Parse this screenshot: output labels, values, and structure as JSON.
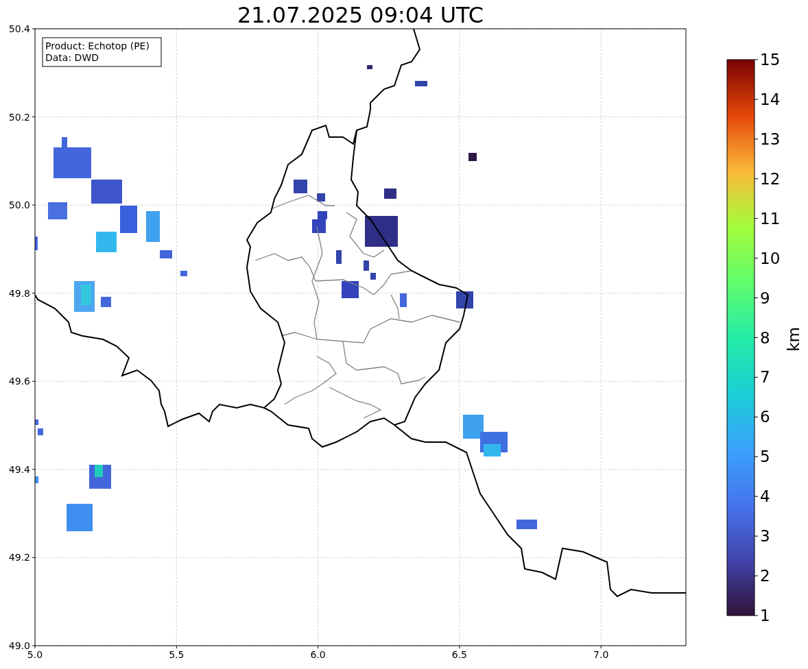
{
  "title": "21.07.2025 09:04 UTC",
  "info_box": {
    "lines": [
      "Product: Echotop (PE)",
      "Data: DWD"
    ]
  },
  "x_axis": {
    "ticks": [
      "5.0",
      "5.5",
      "6.0",
      "6.5",
      "7.0"
    ]
  },
  "y_axis": {
    "ticks": [
      "50.4",
      "50.2",
      "50.0",
      "49.8",
      "49.6",
      "49.4",
      "49.2",
      "49.0"
    ]
  },
  "colorbar": {
    "label": "km",
    "ticks": [
      "15",
      "14",
      "13",
      "12",
      "11",
      "10",
      "9",
      "8",
      "7",
      "6",
      "5",
      "4",
      "3",
      "2",
      "1"
    ]
  }
}
